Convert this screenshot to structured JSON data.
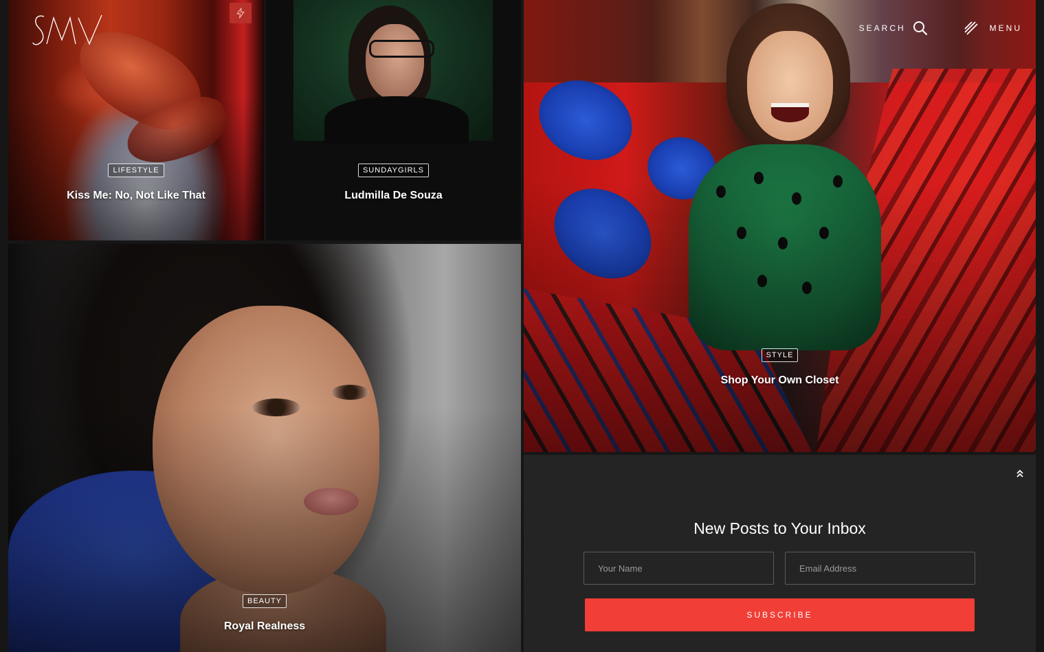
{
  "header": {
    "logo_text": "SMV",
    "search_label": "SEARCH",
    "menu_label": "MENU"
  },
  "tiles": [
    {
      "category": "LIFESTYLE",
      "title": "Kiss Me: No, Not Like That"
    },
    {
      "category": "SUNDAYGIRLS",
      "title": "Ludmilla De Souza"
    },
    {
      "category": "BEAUTY",
      "title": "Royal Realness"
    },
    {
      "category": "STYLE",
      "title": "Shop Your Own Closet"
    }
  ],
  "newsletter": {
    "title": "New Posts to Your Inbox",
    "name_placeholder": "Your Name",
    "email_placeholder": "Email Address",
    "subscribe_label": "SUBSCRIBE"
  },
  "colors": {
    "background": "#161616",
    "panel": "#242424",
    "accent": "#f13e36",
    "badge": "#b7302a"
  },
  "icons": {
    "flash": "lightning-icon",
    "search": "search-icon",
    "menu": "menu-lines-icon",
    "to_top": "double-chevron-up-icon"
  }
}
